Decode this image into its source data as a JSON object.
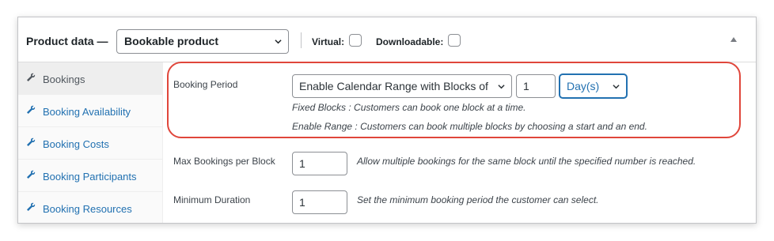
{
  "header": {
    "title": "Product data —",
    "product_type": "Bookable product",
    "virtual_label": "Virtual:",
    "downloadable_label": "Downloadable:"
  },
  "icons": {
    "tab_icon": "wrench-icon",
    "dropdown_icon": "chevron-down-icon",
    "collapse_icon": "triangle-up-icon"
  },
  "sidebar": {
    "items": [
      {
        "label": "Bookings",
        "active": true
      },
      {
        "label": "Booking Availability",
        "active": false
      },
      {
        "label": "Booking Costs",
        "active": false
      },
      {
        "label": "Booking Participants",
        "active": false
      },
      {
        "label": "Booking Resources",
        "active": false
      }
    ]
  },
  "fields": {
    "booking_period": {
      "label": "Booking Period",
      "mode_value": "Enable Calendar Range with Blocks of",
      "quantity_value": "1",
      "unit_value": "Day(s)",
      "desc_fixed": "Fixed Blocks : Customers can book one block at a time.",
      "desc_range": "Enable Range : Customers can book multiple blocks by choosing a start and an end."
    },
    "max_bookings": {
      "label": "Max Bookings per Block",
      "value": "1",
      "description": "Allow multiple bookings for the same block until the specified number is reached."
    },
    "min_duration": {
      "label": "Minimum Duration",
      "value": "1",
      "description": "Set the minimum booking period the customer can select."
    }
  },
  "colors": {
    "highlight": "#e0463b",
    "link": "#2271b1",
    "focus": "#2271b1"
  }
}
